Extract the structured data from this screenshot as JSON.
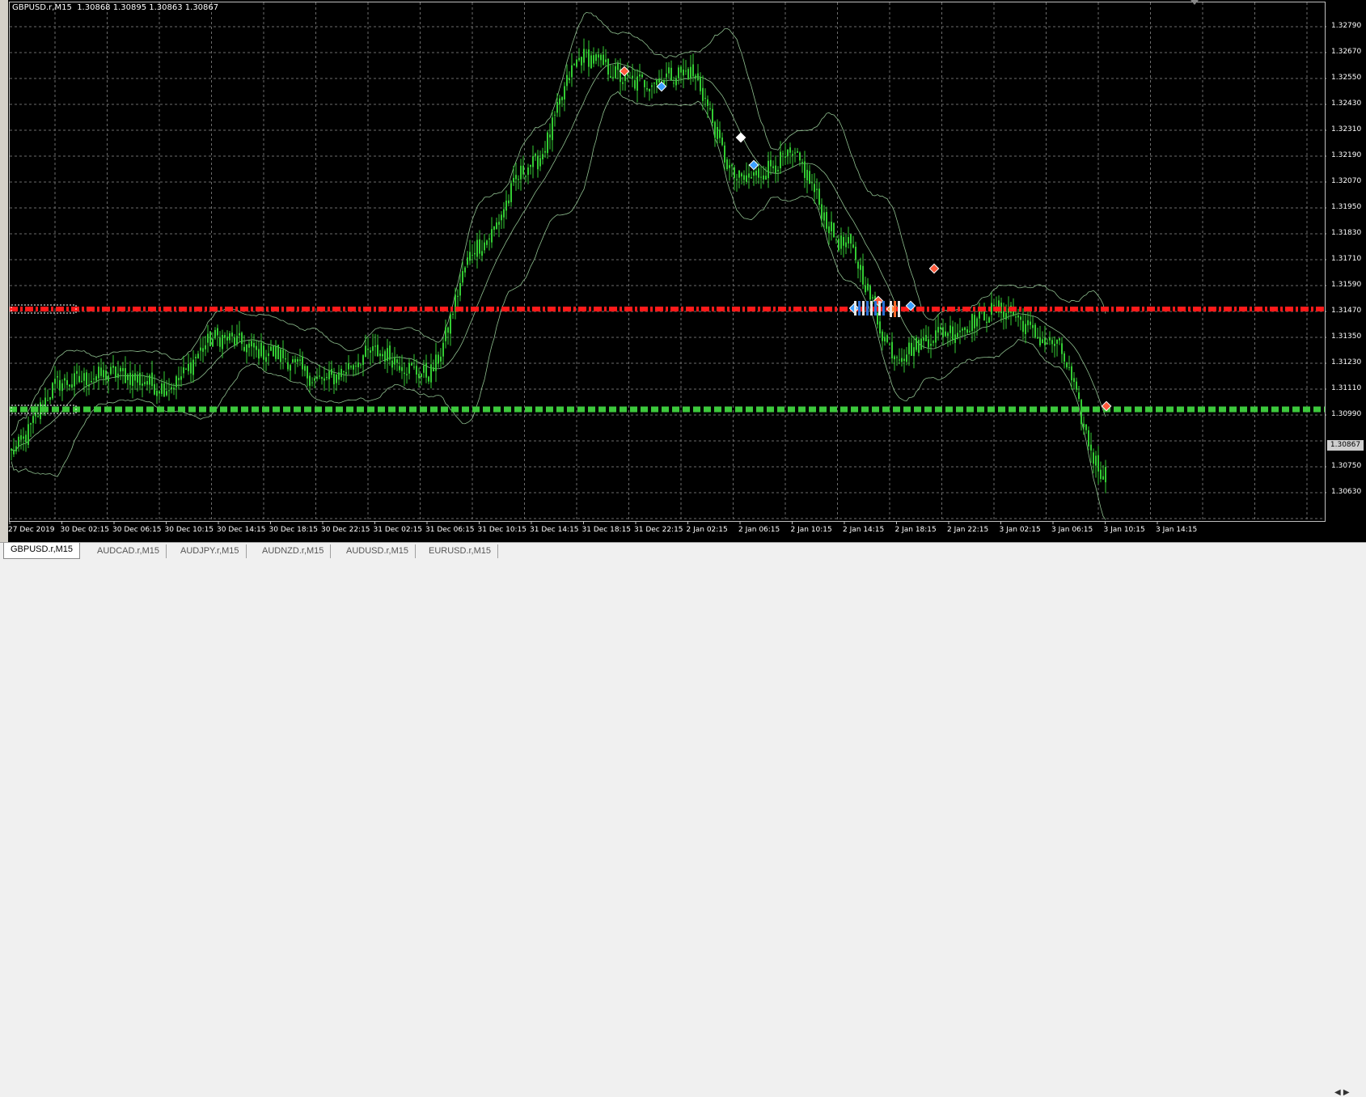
{
  "chart_header": {
    "symbol_text": "GBPUSD.r,M15",
    "ohlc_text": "1.30868 1.30895 1.30863 1.30867"
  },
  "price_axis": {
    "labels": [
      "1.32790",
      "1.32670",
      "1.32550",
      "1.32430",
      "1.32310",
      "1.32190",
      "1.32070",
      "1.31950",
      "1.31830",
      "1.31710",
      "1.31590",
      "1.31470",
      "1.31350",
      "1.31230",
      "1.31110",
      "1.30990",
      "1.30750",
      "1.30630"
    ],
    "current_price": "1.30867"
  },
  "time_axis": {
    "labels": [
      "27 Dec 2019",
      "30 Dec 02:15",
      "30 Dec 06:15",
      "30 Dec 10:15",
      "30 Dec 14:15",
      "30 Dec 18:15",
      "30 Dec 22:15",
      "31 Dec 02:15",
      "31 Dec 06:15",
      "31 Dec 10:15",
      "31 Dec 14:15",
      "31 Dec 18:15",
      "31 Dec 22:15",
      "2 Jan 02:15",
      "2 Jan 06:15",
      "2 Jan 10:15",
      "2 Jan 14:15",
      "2 Jan 18:15",
      "2 Jan 22:15",
      "3 Jan 02:15",
      "3 Jan 06:15",
      "3 Jan 10:15",
      "3 Jan 14:15"
    ]
  },
  "levels": {
    "red_level": {
      "price": 1.3139,
      "color": "#ff1a1a"
    },
    "green_level": {
      "price": 1.30867,
      "color": "#3cc83c"
    }
  },
  "colors": {
    "background": "#000000",
    "grid": "#6b6b6b",
    "candles": "#33cc33",
    "bands": "#8fbf8f"
  },
  "tabs": [
    {
      "label": "GBPUSD.r,M15",
      "active": true
    },
    {
      "label": "AUDCAD.r,M15",
      "active": false
    },
    {
      "label": "AUDJPY.r,M15",
      "active": false
    },
    {
      "label": "AUDNZD.r,M15",
      "active": false
    },
    {
      "label": "AUDUSD.r,M15",
      "active": false
    },
    {
      "label": "EURUSD.r,M15",
      "active": false
    }
  ],
  "tab_scroll_icons": [
    "arrow-left-icon",
    "arrow-right-icon"
  ],
  "chart_data": {
    "type": "line",
    "x_labels": [
      "27 Dec 2019",
      "30 Dec 02:15",
      "30 Dec 06:15",
      "30 Dec 10:15",
      "30 Dec 14:15",
      "30 Dec 18:15",
      "30 Dec 22:15",
      "31 Dec 02:15",
      "31 Dec 06:15",
      "31 Dec 10:15",
      "31 Dec 14:15",
      "31 Dec 18:15",
      "31 Dec 22:15",
      "2 Jan 02:15",
      "2 Jan 06:15",
      "2 Jan 10:15",
      "2 Jan 14:15",
      "2 Jan 18:15",
      "2 Jan 22:15",
      "3 Jan 02:15",
      "3 Jan 06:15",
      "3 Jan 10:15",
      "3 Jan 14:15"
    ],
    "price_points": [
      {
        "x": "27 Dec 2019",
        "y": 1.3082
      },
      {
        "x": "30 Dec 02:15",
        "y": 1.3114
      },
      {
        "x": "30 Dec 06:15",
        "y": 1.3118
      },
      {
        "x": "30 Dec 10:15",
        "y": 1.3112
      },
      {
        "x": "30 Dec 14:15",
        "y": 1.3135
      },
      {
        "x": "30 Dec 18:15",
        "y": 1.3128
      },
      {
        "x": "30 Dec 22:15",
        "y": 1.3115
      },
      {
        "x": "31 Dec 02:15",
        "y": 1.3128
      },
      {
        "x": "31 Dec 06:15",
        "y": 1.3118
      },
      {
        "x": "31 Dec 10:15",
        "y": 1.3178
      },
      {
        "x": "31 Dec 14:15",
        "y": 1.3215
      },
      {
        "x": "31 Dec 18:15",
        "y": 1.3265
      },
      {
        "x": "31 Dec 22:15",
        "y": 1.3253
      },
      {
        "x": "2 Jan 02:15",
        "y": 1.3258
      },
      {
        "x": "2 Jan 06:15",
        "y": 1.3208
      },
      {
        "x": "2 Jan 10:15",
        "y": 1.3218
      },
      {
        "x": "2 Jan 14:15",
        "y": 1.3178
      },
      {
        "x": "2 Jan 18:15",
        "y": 1.3128
      },
      {
        "x": "2 Jan 22:15",
        "y": 1.3138
      },
      {
        "x": "3 Jan 02:15",
        "y": 1.3148
      },
      {
        "x": "3 Jan 06:15",
        "y": 1.3132
      },
      {
        "x": "3 Jan 10:15",
        "y": 1.3072
      },
      {
        "x": "3 Jan 14:15",
        "y": 1.3084
      }
    ],
    "ylim": [
      1.3055,
      1.3285
    ],
    "horizontal_levels": [
      1.3139,
      1.30867
    ],
    "grid": true,
    "xlabel": "",
    "ylabel": "",
    "title": ""
  }
}
